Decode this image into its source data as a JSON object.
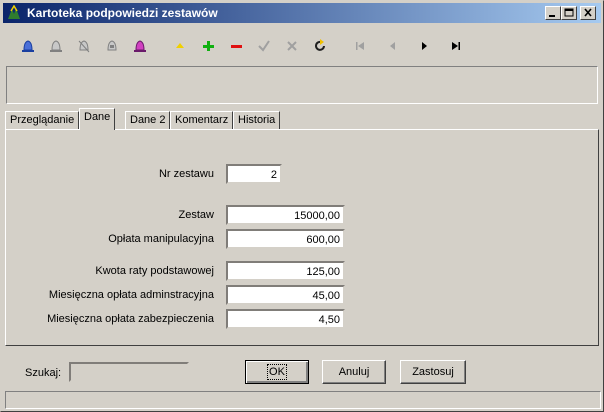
{
  "window": {
    "title": "Kartoteka podpowiedzi zestawów"
  },
  "toolbar": {
    "icons": [
      "bell-blue-icon",
      "bell-gray-icon",
      "bell-strike-icon",
      "bell-clear-icon",
      "bell-magenta-icon",
      "arrow-up-yellow-icon",
      "plus-green-icon",
      "minus-red-icon",
      "check-icon",
      "cancel-x-icon",
      "refresh-icon",
      "first-record-icon",
      "prev-record-icon",
      "next-record-icon",
      "last-record-icon"
    ]
  },
  "tabs": [
    "Przeglądanie",
    "Dane",
    "Dane 2",
    "Komentarz",
    "Historia"
  ],
  "active_tab": "Dane",
  "form": {
    "nr_zestawu": {
      "label": "Nr zestawu",
      "value": "2"
    },
    "zestaw": {
      "label": "Zestaw",
      "value": "15000,00"
    },
    "oplata_manipulacyjna": {
      "label": "Opłata manipulacyjna",
      "value": "600,00"
    },
    "kwota_raty": {
      "label": "Kwota raty podstawowej",
      "value": "125,00"
    },
    "oplata_admin": {
      "label": "Miesięczna opłata adminstracyjna",
      "value": "45,00"
    },
    "oplata_zabezp": {
      "label": "Miesięczna opłata zabezpieczenia",
      "value": "4,50"
    }
  },
  "bottom": {
    "search_label": "Szukaj:",
    "search_value": "",
    "ok_label": "OK",
    "cancel_label": "Anuluj",
    "apply_label": "Zastosuj"
  },
  "colors": {
    "title_start": "#0a246a",
    "title_end": "#a6caf0",
    "face": "#d4d0c8"
  }
}
